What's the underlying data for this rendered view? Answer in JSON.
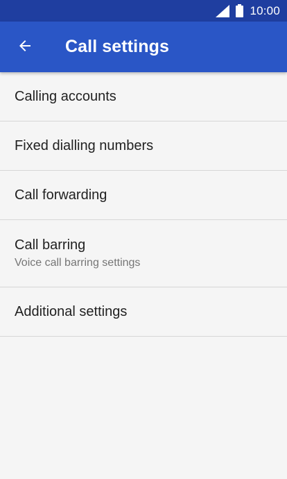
{
  "status_bar": {
    "time": "10:00",
    "signal_icon": "cell-signal-icon",
    "battery_icon": "battery-full-icon"
  },
  "app_bar": {
    "back_icon": "arrow-back-icon",
    "title": "Call settings"
  },
  "settings": {
    "items": [
      {
        "label": "Calling accounts"
      },
      {
        "label": "Fixed dialling numbers"
      },
      {
        "label": "Call forwarding"
      },
      {
        "label": "Call barring",
        "summary": "Voice call barring settings"
      },
      {
        "label": "Additional settings"
      }
    ]
  },
  "colors": {
    "status_bar": "#1f3ea0",
    "app_bar": "#2a56c6",
    "background": "#f5f5f5",
    "divider": "#d6d6d6",
    "primary_text": "#212121",
    "secondary_text": "#757575"
  }
}
